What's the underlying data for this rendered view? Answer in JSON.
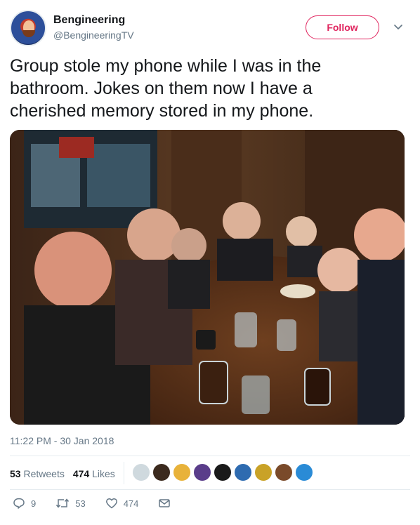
{
  "author": {
    "name": "Bengineering",
    "handle": "@BengineeringTV"
  },
  "follow_label": "Follow",
  "tweet": {
    "line1": "Group stole my phone while I was in the",
    "line2": "bathroom. Jokes on them now I have a",
    "line3": "cherished memory stored in my phone."
  },
  "timestamp": "11:22 PM - 30 Jan 2018",
  "stats": {
    "retweets_count": "53",
    "retweets_label": "Retweets",
    "likes_count": "474",
    "likes_label": "Likes"
  },
  "actions": {
    "replies": "9",
    "retweets": "53",
    "likes": "474"
  },
  "colors": {
    "accent": "#e0245e",
    "muted": "#657786",
    "text": "#14171a"
  },
  "liker_colors": [
    "#cfd9de",
    "#3b2a1e",
    "#e8b23a",
    "#5a3d8a",
    "#1a1a1a",
    "#2e6bb0",
    "#c9a227",
    "#7a4a2a",
    "#2a8bd6"
  ]
}
